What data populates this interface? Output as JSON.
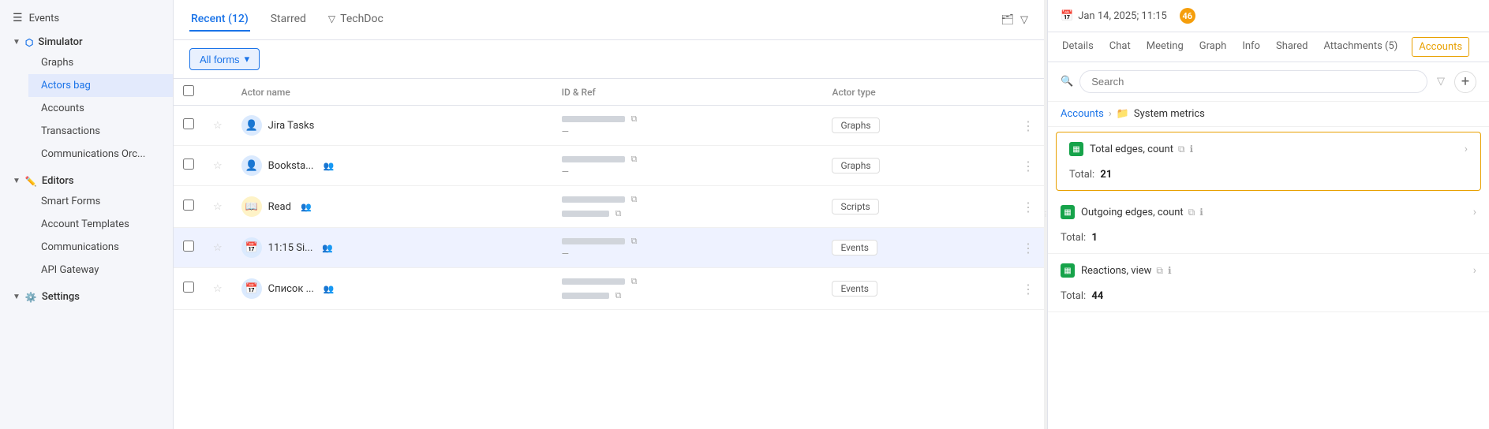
{
  "sidebar": {
    "items": [
      {
        "id": "events",
        "label": "Events",
        "icon": "☰",
        "level": 0,
        "indent": false
      },
      {
        "id": "simulator",
        "label": "Simulator",
        "icon": "🔷",
        "level": 0,
        "arrow": "▼",
        "expanded": true
      },
      {
        "id": "graphs",
        "label": "Graphs",
        "icon": "",
        "level": 1
      },
      {
        "id": "actors-bag",
        "label": "Actors bag",
        "icon": "",
        "level": 1,
        "active": true
      },
      {
        "id": "accounts",
        "label": "Accounts",
        "icon": "",
        "level": 1
      },
      {
        "id": "transactions",
        "label": "Transactions",
        "icon": "",
        "level": 1
      },
      {
        "id": "communications",
        "label": "Communications Orc...",
        "icon": "",
        "level": 1
      },
      {
        "id": "editors",
        "label": "Editors",
        "icon": "✏️",
        "level": 0,
        "arrow": "▼",
        "expanded": true
      },
      {
        "id": "smart-forms",
        "label": "Smart Forms",
        "icon": "",
        "level": 1
      },
      {
        "id": "account-templates",
        "label": "Account Templates",
        "icon": "",
        "level": 1
      },
      {
        "id": "communications2",
        "label": "Communications",
        "icon": "",
        "level": 1
      },
      {
        "id": "api-gateway",
        "label": "API Gateway",
        "icon": "",
        "level": 1
      },
      {
        "id": "settings",
        "label": "Settings",
        "icon": "⚙️",
        "level": 0,
        "arrow": "▼"
      }
    ]
  },
  "main": {
    "tabs": [
      {
        "id": "recent",
        "label": "Recent (12)",
        "active": true
      },
      {
        "id": "starred",
        "label": "Starred",
        "active": false
      },
      {
        "id": "techdoc",
        "label": "TechDoc",
        "active": false,
        "has_filter": true
      }
    ],
    "filter": {
      "label": "All forms",
      "dropdown_arrow": "▾"
    },
    "table": {
      "columns": [
        "",
        "",
        "Actor name",
        "ID & Ref",
        "Actor type",
        ""
      ],
      "rows": [
        {
          "id": 1,
          "name": "Jira Tasks",
          "icon_type": "person",
          "actor_type": "Graphs",
          "selected": false
        },
        {
          "id": 2,
          "name": "Booksta...",
          "icon_type": "person",
          "actor_type": "Graphs",
          "selected": false,
          "has_user": true
        },
        {
          "id": 3,
          "name": "Read",
          "icon_type": "book",
          "actor_type": "Scripts",
          "selected": false,
          "has_user": true
        },
        {
          "id": 4,
          "name": "11:15 Si...",
          "icon_type": "calendar",
          "actor_type": "Events",
          "selected": true,
          "has_user": true
        },
        {
          "id": 5,
          "name": "Список ...",
          "icon_type": "calendar",
          "actor_type": "Events",
          "selected": false,
          "has_user": true
        }
      ]
    }
  },
  "right_panel": {
    "header": {
      "date": "Jan 14, 2025; 11:15",
      "coin_count": "46"
    },
    "tabs": [
      {
        "id": "details",
        "label": "Details"
      },
      {
        "id": "chat",
        "label": "Chat"
      },
      {
        "id": "meeting",
        "label": "Meeting"
      },
      {
        "id": "graph",
        "label": "Graph"
      },
      {
        "id": "info",
        "label": "Info"
      },
      {
        "id": "shared",
        "label": "Shared"
      },
      {
        "id": "attachments",
        "label": "Attachments (5)"
      },
      {
        "id": "accounts",
        "label": "Accounts",
        "active": true
      }
    ],
    "search": {
      "placeholder": "Search"
    },
    "breadcrumb": {
      "root": "Accounts",
      "child": "System metrics",
      "folder_icon": "📁"
    },
    "metrics": [
      {
        "id": "total-edges",
        "name": "Total edges, count",
        "total_label": "Total:",
        "total_value": "21",
        "highlighted": true
      },
      {
        "id": "outgoing-edges",
        "name": "Outgoing edges, count",
        "total_label": "Total:",
        "total_value": "1",
        "highlighted": false
      },
      {
        "id": "reactions-view",
        "name": "Reactions, view",
        "total_label": "Total:",
        "total_value": "44",
        "highlighted": false
      }
    ]
  },
  "icons": {
    "calendar_icon": "📅",
    "filter_icon": "⊳",
    "folder_icon": "🗂",
    "search_icon": "🔍",
    "copy_icon": "⧉",
    "info_icon": "ℹ",
    "add_icon": "+",
    "chevron_right": "›",
    "more_icon": "⋮",
    "star_empty": "☆",
    "check_empty": "□"
  }
}
